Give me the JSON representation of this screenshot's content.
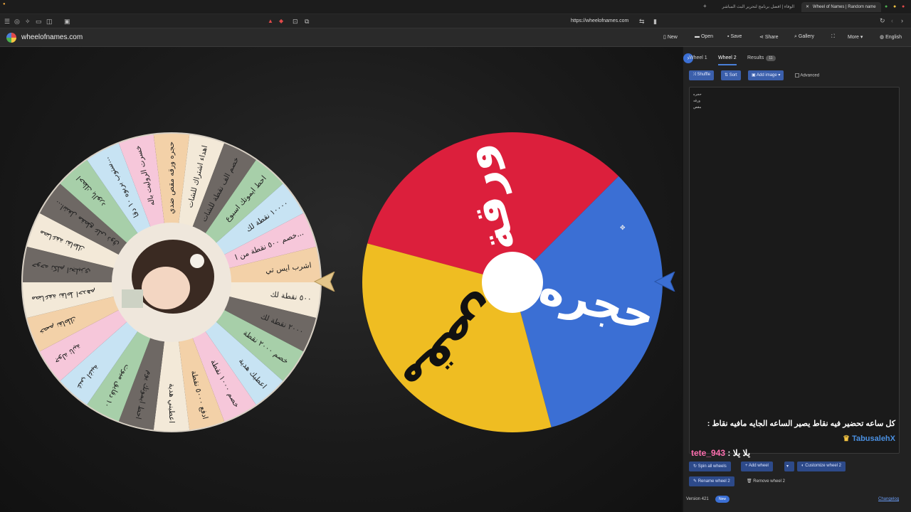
{
  "browser": {
    "tabs": [
      {
        "label": "الوفاء | افضل برنامج لتحرير البث المباشر"
      },
      {
        "label": "Wheel of Names | Random name"
      }
    ],
    "url": "https://wheelofnames.com"
  },
  "app": {
    "logo_text": "wheelofnames.com",
    "menu": {
      "new": "New",
      "open": "Open",
      "save": "Save",
      "share": "Share",
      "gallery": "Gallery",
      "more": "More",
      "language": "English"
    }
  },
  "wheel1": {
    "segments": [
      "مضاعفة نقاطك",
      "اشغل مقطع على ذوق...",
      "احظك بالورد",
      "ستوب بربوه ١٠ دقا...",
      "خسرت الروليت باله",
      "حجره ورقه مقص ضدي",
      "اهداء اشتراك للشات",
      "خصم الف نقطة للشات",
      "احط ايموتك اسبوع",
      "١٠٠٠٠ نقطة لك",
      "خصم ٥٠٠ نقطة من ا...",
      "اشرب ايس تي",
      "٥٠٠ نقطة لك",
      "٢٠٠٠ نقطة لك",
      "خصم ٢٠٠٠ نقطة",
      "اعطيك هدية",
      "خصم ١٠٠٠ نقطة",
      "ادفع ٥٠٠٠ نقطة",
      "اعطيني هدية",
      "احط ايموتك يوم",
      "١٠ دقايق ميوت",
      "غني اغنية",
      "جولة ثانية",
      "خصم نقاطك",
      "مضاعفة نقاط احدهم",
      "حوحه تكلم انجليزي"
    ],
    "colors": [
      "#f3e9d8",
      "#6e6864",
      "#a7cfa9",
      "#c7e3f3",
      "#f6c7da",
      "#f3d1a8"
    ]
  },
  "wheel2": {
    "segments": [
      {
        "label": "ورقة",
        "color": "#dc1f3c"
      },
      {
        "label": "حجره",
        "color": "#3b6fd4"
      },
      {
        "label": "مقص",
        "color": "#efbd22"
      }
    ]
  },
  "sidebar": {
    "tabs": {
      "wheel1": "Wheel 1",
      "wheel2": "Wheel 2",
      "results": "Results",
      "results_count": "11"
    },
    "toolbar": {
      "shuffle": "Shuffle",
      "sort": "Sort",
      "add_image": "Add image",
      "advanced": "Advanced"
    },
    "entries": [
      "حجره",
      "ورقه",
      "مقص"
    ],
    "chat": [
      {
        "user": "TabusalehX",
        "message": "كل ساعه تحضير فيه نقاط يصير الساعه الجايه مافيه نقاط",
        "user_color": "#4a90e2"
      },
      {
        "user": "tete_943",
        "message": "يلا يلا",
        "user_color": "#ff6fb0"
      }
    ],
    "actions": {
      "spin_all": "Spin all wheels",
      "add_wheel": "Add wheel",
      "customize": "Customize wheel 2",
      "rename": "Rename wheel 2",
      "remove": "Remove wheel 2"
    },
    "footer": {
      "version": "Version 421",
      "new_badge": "New",
      "changelog": "Changelog"
    }
  }
}
